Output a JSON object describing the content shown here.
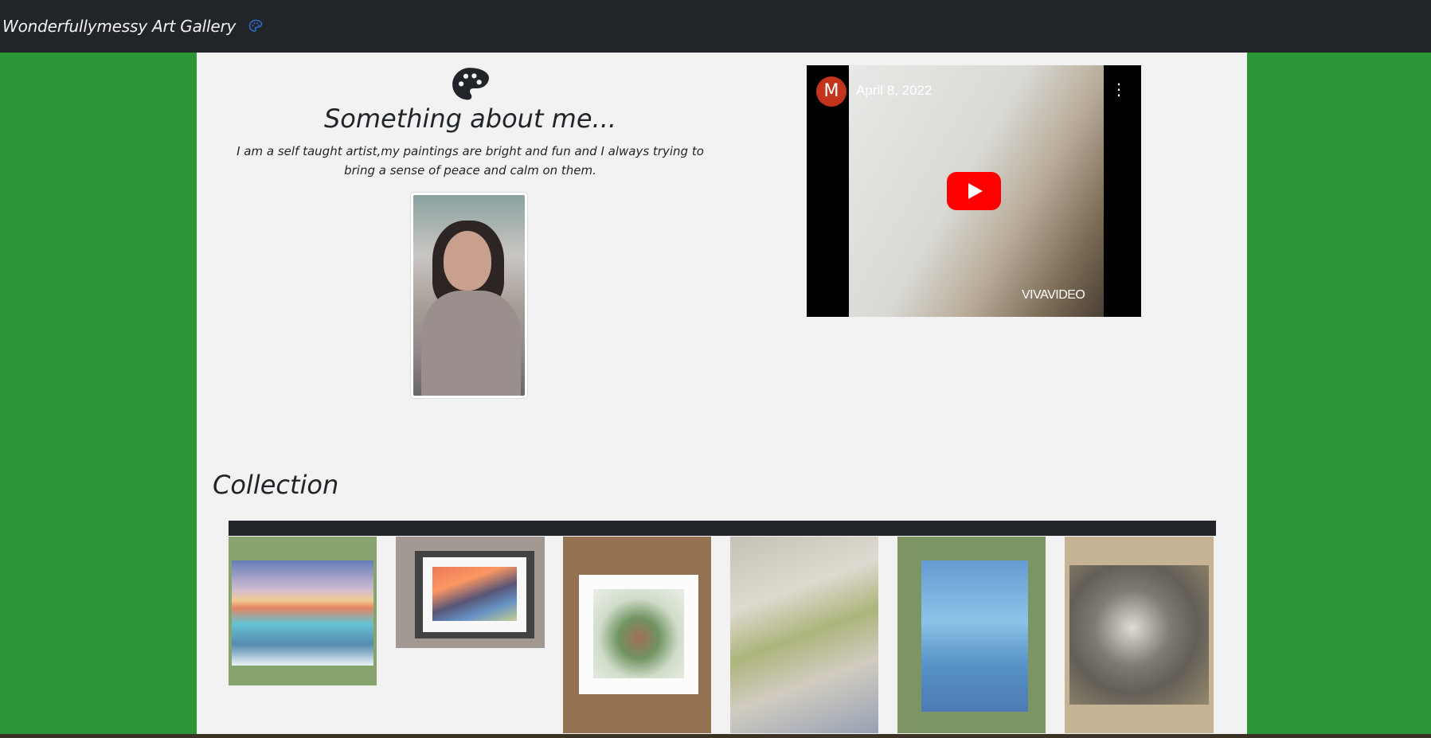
{
  "navbar": {
    "brand": "Wonderfullymessy Art Gallery",
    "brand_icon": "palette-icon"
  },
  "about": {
    "title": "Something about me...",
    "text": "I am a self taught artist,my paintings are bright and fun and I always trying to bring a sense of peace and calm on them.",
    "portrait_alt": "artist-portrait"
  },
  "video": {
    "channel_initial": "M",
    "date": "April 8, 2022",
    "watermark": "VIVAVIDEO"
  },
  "collection": {
    "title": "Collection",
    "items": [
      {
        "name": "sunset-waves-painting"
      },
      {
        "name": "framed-wave-painting"
      },
      {
        "name": "framed-abstract-painting"
      },
      {
        "name": "textured-abstract-painting"
      },
      {
        "name": "blue-water-painting"
      },
      {
        "name": "sphere-painting"
      }
    ]
  },
  "colors": {
    "page_background": "#2a9636",
    "navbar_background": "#212428",
    "content_background": "#f2f2f2",
    "play_button": "#ff0000",
    "avatar": "#c2341b"
  }
}
